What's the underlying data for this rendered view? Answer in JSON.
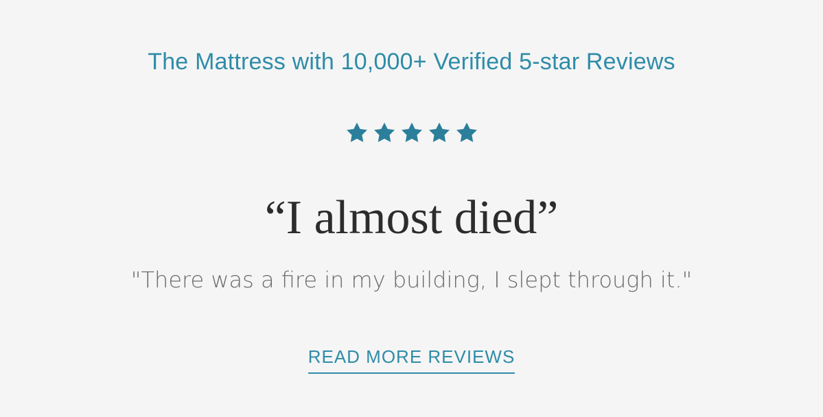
{
  "headline": "The Mattress with 10,000+ Verified 5-star Reviews",
  "rating": {
    "stars": 5,
    "max": 5,
    "icon": "star-icon",
    "color": "#2b7f9a"
  },
  "review": {
    "title": "“I almost died”",
    "quote": "\"There was a fire in my building, I slept through it.\""
  },
  "cta": {
    "label": "READ MORE REVIEWS"
  },
  "colors": {
    "accent": "#2e8ca8",
    "background": "#f5f5f5",
    "title": "#2c2c2c",
    "body": "#6b6b6b"
  }
}
